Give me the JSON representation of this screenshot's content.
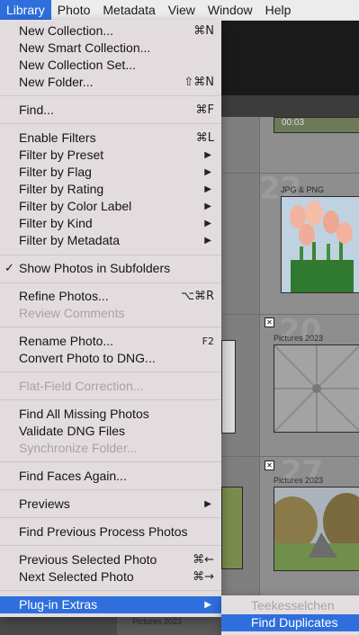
{
  "menubar": {
    "items": [
      "Library",
      "Photo",
      "Metadata",
      "View",
      "Window",
      "Help"
    ],
    "active": "Library"
  },
  "menu": {
    "items": [
      {
        "label": "New Collection...",
        "shortcut": "⌘N"
      },
      {
        "label": "New Smart Collection...",
        "shortcut": ""
      },
      {
        "label": "New Collection Set...",
        "shortcut": ""
      },
      {
        "label": "New Folder...",
        "shortcut": "⇧⌘N"
      },
      {
        "label": "Find...",
        "shortcut": "⌘F"
      },
      {
        "label": "Enable Filters",
        "shortcut": "⌘L"
      },
      {
        "label": "Filter by Preset",
        "shortcut": ""
      },
      {
        "label": "Filter by Flag",
        "shortcut": ""
      },
      {
        "label": "Filter by Rating",
        "shortcut": ""
      },
      {
        "label": "Filter by Color Label",
        "shortcut": ""
      },
      {
        "label": "Filter by Kind",
        "shortcut": ""
      },
      {
        "label": "Filter by Metadata",
        "shortcut": ""
      },
      {
        "label": "Show Photos in Subfolders",
        "shortcut": "",
        "check": "✓"
      },
      {
        "label": "Refine Photos...",
        "shortcut": "⌥⌘R"
      },
      {
        "label": "Review Comments",
        "shortcut": ""
      },
      {
        "label": "Rename Photo...",
        "shortcut": "F2"
      },
      {
        "label": "Convert Photo to DNG...",
        "shortcut": ""
      },
      {
        "label": "Flat-Field Correction...",
        "shortcut": ""
      },
      {
        "label": "Find All Missing Photos",
        "shortcut": ""
      },
      {
        "label": "Validate DNG Files",
        "shortcut": ""
      },
      {
        "label": "Synchronize Folder...",
        "shortcut": ""
      },
      {
        "label": "Find Faces Again...",
        "shortcut": ""
      },
      {
        "label": "Previews",
        "shortcut": ""
      },
      {
        "label": "Find Previous Process Photos",
        "shortcut": ""
      },
      {
        "label": "Previous Selected Photo",
        "shortcut": "⌘←"
      },
      {
        "label": "Next Selected Photo",
        "shortcut": "⌘→"
      },
      {
        "label": "Plug-in Extras",
        "shortcut": ""
      }
    ]
  },
  "submenu": {
    "items": [
      {
        "label": "Teekesselchen"
      },
      {
        "label": "Find Duplicates"
      }
    ]
  },
  "background": {
    "folder_labels": [
      "JPG & PNG",
      "Pictures 2023",
      "Pictures 2023",
      "Pictures 2023"
    ],
    "cell_numbers": [
      "22",
      "20",
      "27"
    ],
    "timecode": "00:03"
  },
  "colors": {
    "highlight": "#2f6fdd",
    "menu_bg": "#e8e1e4",
    "disabled_text": "#a8a2a5"
  }
}
